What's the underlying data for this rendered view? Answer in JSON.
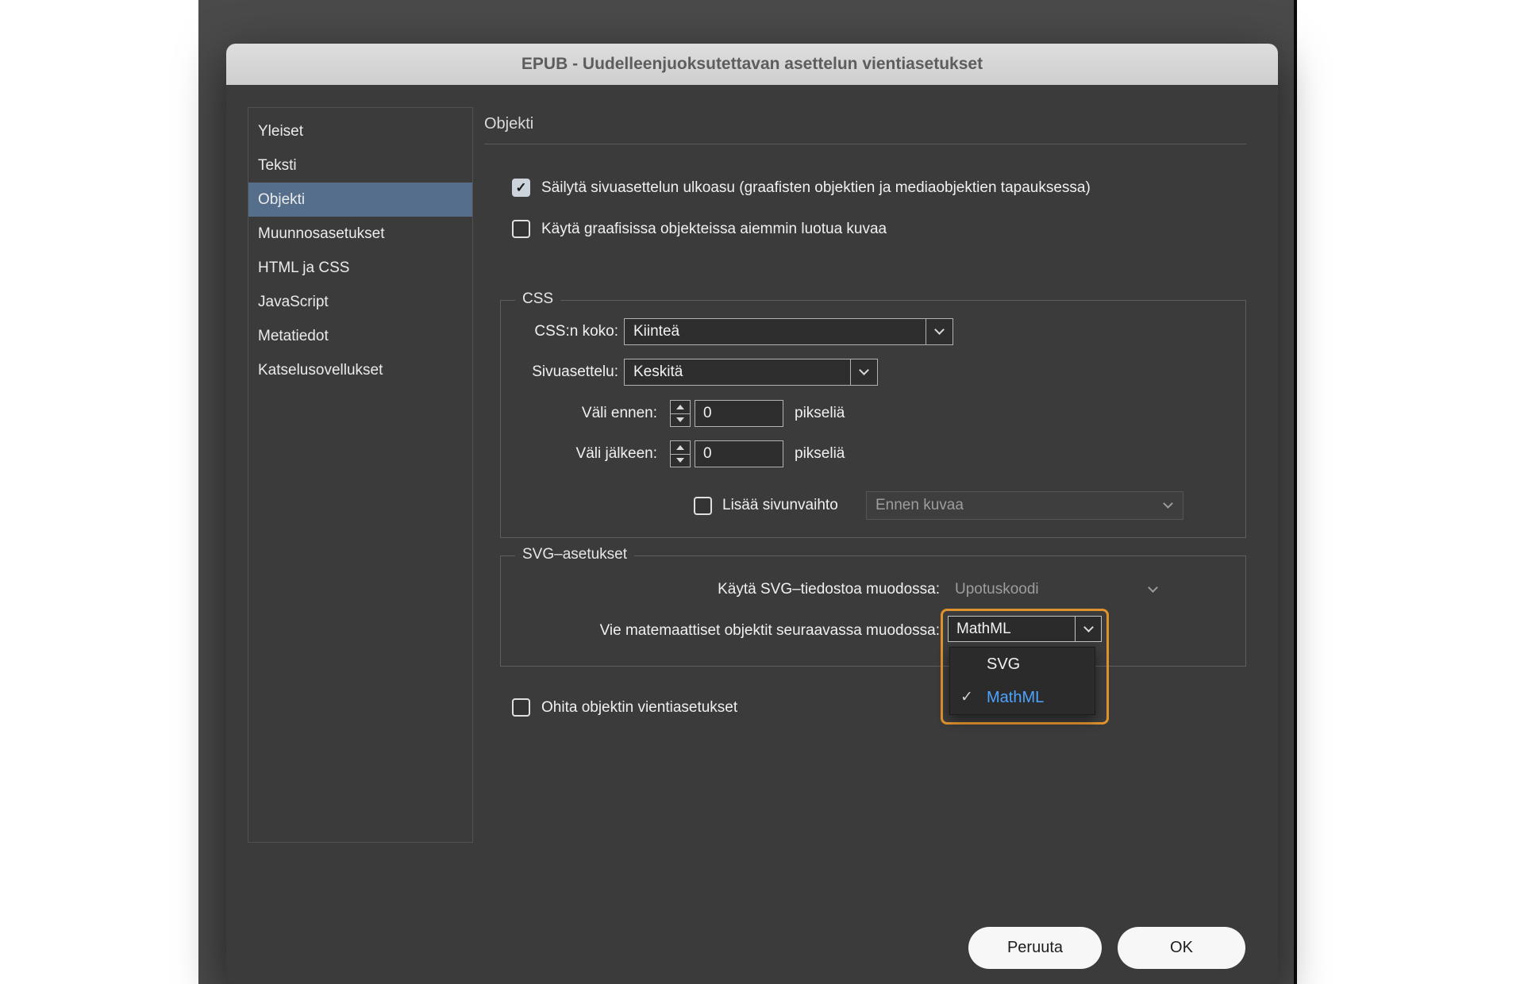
{
  "window": {
    "title": "EPUB - Uudelleenjuoksutettavan asettelun vientiasetukset"
  },
  "sidebar": {
    "items": [
      {
        "label": "Yleiset",
        "selected": false
      },
      {
        "label": "Teksti",
        "selected": false
      },
      {
        "label": "Objekti",
        "selected": true
      },
      {
        "label": "Muunnosasetukset",
        "selected": false
      },
      {
        "label": "HTML ja CSS",
        "selected": false
      },
      {
        "label": "JavaScript",
        "selected": false
      },
      {
        "label": "Metatiedot",
        "selected": false
      },
      {
        "label": "Katselusovellukset",
        "selected": false
      }
    ]
  },
  "main": {
    "heading": "Objekti",
    "checkboxes": {
      "preserve_layout": {
        "label": "Säilytä sivuasettelun ulkoasu (graafisten objektien ja mediaobjektien tapauksessa)",
        "checked": true
      },
      "use_existing_image": {
        "label": "Käytä graafisissa objekteissa aiemmin luotua kuvaa",
        "checked": false
      },
      "ignore_export": {
        "label": "Ohita objektin vientiasetukset",
        "checked": false
      }
    },
    "css": {
      "legend": "CSS",
      "size": {
        "label": "CSS:n koko:",
        "value": "Kiinteä"
      },
      "layout": {
        "label": "Sivuasettelu:",
        "value": "Keskitä"
      },
      "space_before": {
        "label": "Väli ennen:",
        "value": "0",
        "unit": "pikseliä"
      },
      "space_after": {
        "label": "Väli jälkeen:",
        "value": "0",
        "unit": "pikseliä"
      },
      "page_break": {
        "label": "Lisää sivunvaihto",
        "value": "Ennen kuvaa",
        "checked": false,
        "dropdown_disabled": true
      }
    },
    "svg": {
      "legend": "SVG–asetukset",
      "use_svg": {
        "label": "Käytä SVG–tiedostoa muodossa:",
        "value": "Upotuskoodi",
        "disabled": true
      },
      "math_export": {
        "label": "Vie matemaattiset objektit seuraavassa muodossa:",
        "value": "MathML"
      },
      "dropdown_options": [
        {
          "label": "SVG",
          "selected": false
        },
        {
          "label": "MathML",
          "selected": true
        }
      ]
    }
  },
  "footer": {
    "cancel": "Peruuta",
    "ok": "OK"
  },
  "icons": {
    "check": "✓"
  },
  "colors": {
    "highlight_outline": "#E0922F",
    "sidebar_selection": "#546E8C",
    "selected_option_text": "#4DA3FF",
    "dialog_background": "#3B3B3B",
    "titlebar_background": "#D6D6D6"
  }
}
